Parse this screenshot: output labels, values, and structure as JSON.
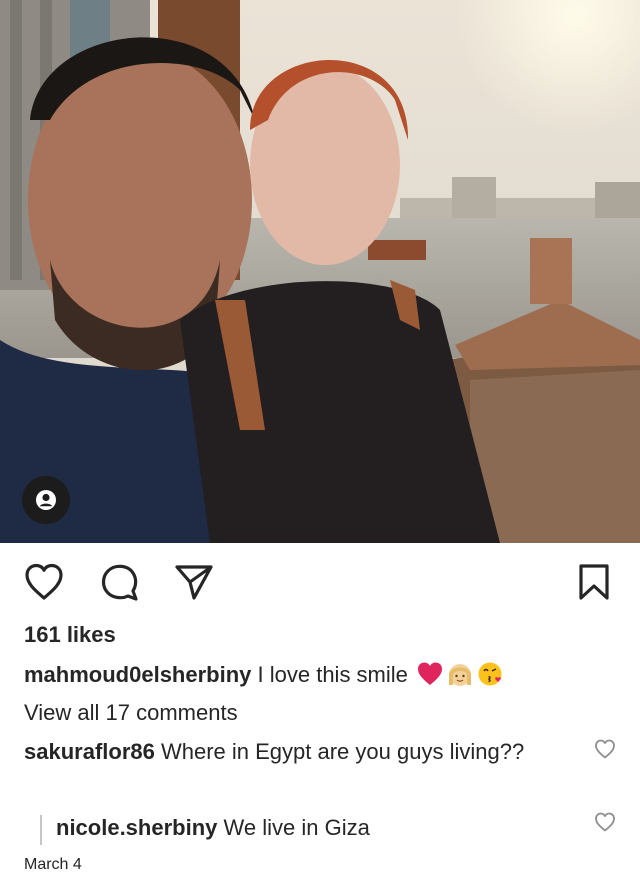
{
  "post": {
    "likes": "161 likes",
    "caption": {
      "username": "mahmoud0elsherbiny",
      "text": "I love this smile"
    },
    "view_all_comments": "View all 17 comments",
    "comments": [
      {
        "username": "sakuraflor86",
        "text": "Where in Egypt are you guys living??"
      }
    ],
    "replies": [
      {
        "username": "nicole.sherbiny",
        "text": "We live in Giza"
      }
    ],
    "date": "March 4"
  },
  "icons": {
    "like": "heart-outline-icon",
    "comment": "comment-bubble-icon",
    "share": "paper-plane-icon",
    "save": "bookmark-icon",
    "user_tag": "user-tag-icon"
  },
  "colors": {
    "text": "#262626",
    "heart_emoji": "#e0245e",
    "reply_bar": "#c7c7c7"
  }
}
